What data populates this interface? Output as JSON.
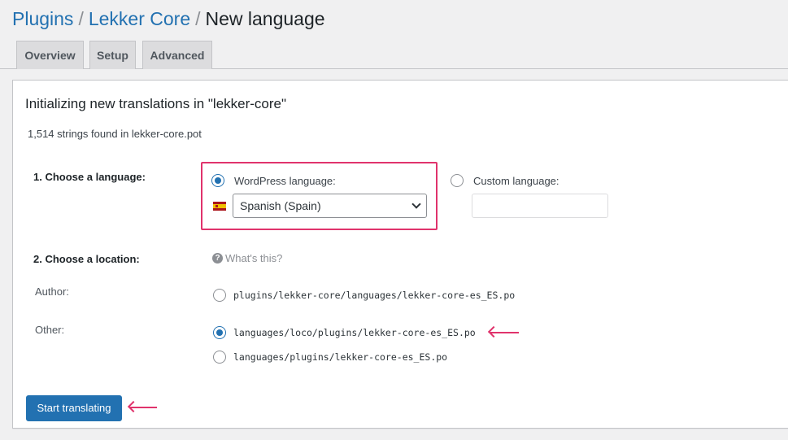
{
  "breadcrumbs": [
    "Plugins",
    "Lekker Core",
    "New language"
  ],
  "breadcrumb_separator": "/",
  "tabs": [
    {
      "label": "Overview"
    },
    {
      "label": "Setup"
    },
    {
      "label": "Advanced"
    }
  ],
  "panel": {
    "title": "Initializing new translations in \"lekker-core\"",
    "strings_found": "1,514 strings found in lekker-core.pot"
  },
  "language": {
    "label": "1. Choose a language:",
    "wordpress_option": "WordPress language:",
    "wordpress_selected": true,
    "selected_language": "Spanish (Spain)",
    "custom_option": "Custom language:",
    "custom_value": ""
  },
  "location": {
    "label": "2. Choose a location:",
    "help_link": "What's this?",
    "author_label": "Author:",
    "author_path": "plugins/lekker-core/languages/lekker-core-es_ES.po",
    "other_label": "Other:",
    "other_paths": [
      {
        "path": "languages/loco/plugins/lekker-core-es_ES.po",
        "selected": true
      },
      {
        "path": "languages/plugins/lekker-core-es_ES.po",
        "selected": false
      }
    ]
  },
  "submit_label": "Start translating",
  "colors": {
    "link": "#2271b1",
    "primary_button": "#2271b1",
    "highlight": "#e0336c"
  },
  "icons": {
    "help": "question-circle-icon",
    "flag": "spain-flag-icon",
    "select_arrow": "chevron-down-icon",
    "annotation": "arrow-left-icon"
  }
}
